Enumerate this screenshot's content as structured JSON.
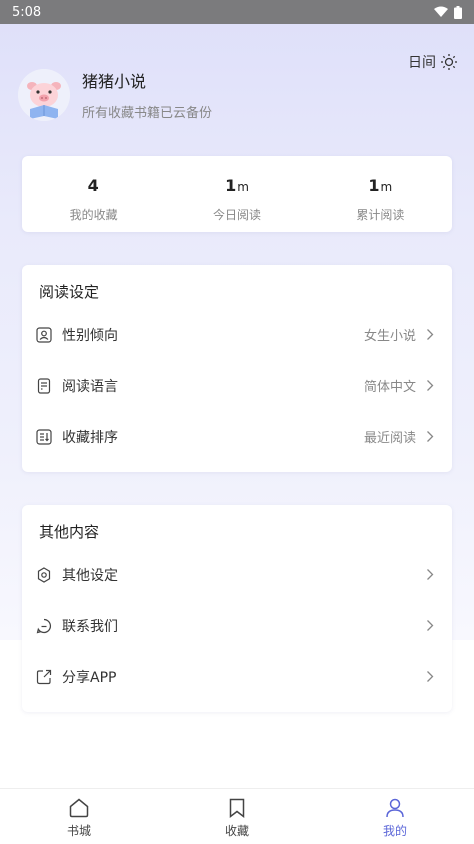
{
  "status_bar": {
    "time": "5:08"
  },
  "mode_toggle": {
    "label": "日间",
    "icon": "sun-icon"
  },
  "profile": {
    "name": "猪猪小说",
    "subtitle": "所有收藏书籍已云备份",
    "avatar_icon": "pig-reading-avatar"
  },
  "stats": [
    {
      "value": "4",
      "unit": "",
      "label": "我的收藏"
    },
    {
      "value": "1",
      "unit": "m",
      "label": "今日阅读"
    },
    {
      "value": "1",
      "unit": "m",
      "label": "累计阅读"
    }
  ],
  "reading_settings": {
    "title": "阅读设定",
    "items": [
      {
        "icon": "user-portrait-icon",
        "label": "性别倾向",
        "value": "女生小说"
      },
      {
        "icon": "document-icon",
        "label": "阅读语言",
        "value": "简体中文"
      },
      {
        "icon": "sort-list-icon",
        "label": "收藏排序",
        "value": "最近阅读"
      }
    ]
  },
  "other_content": {
    "title": "其他内容",
    "items": [
      {
        "icon": "gear-icon",
        "label": "其他设定"
      },
      {
        "icon": "chat-bubble-icon",
        "label": "联系我们"
      },
      {
        "icon": "share-icon",
        "label": "分享APP"
      }
    ]
  },
  "tabbar": [
    {
      "icon": "home-icon",
      "label": "书城",
      "active": false
    },
    {
      "icon": "bookmark-icon",
      "label": "收藏",
      "active": false
    },
    {
      "icon": "person-icon",
      "label": "我的",
      "active": true
    }
  ],
  "colors": {
    "accent": "#5b66d8",
    "header_gradient_top": "#dedff9",
    "text_secondary": "#888888"
  }
}
